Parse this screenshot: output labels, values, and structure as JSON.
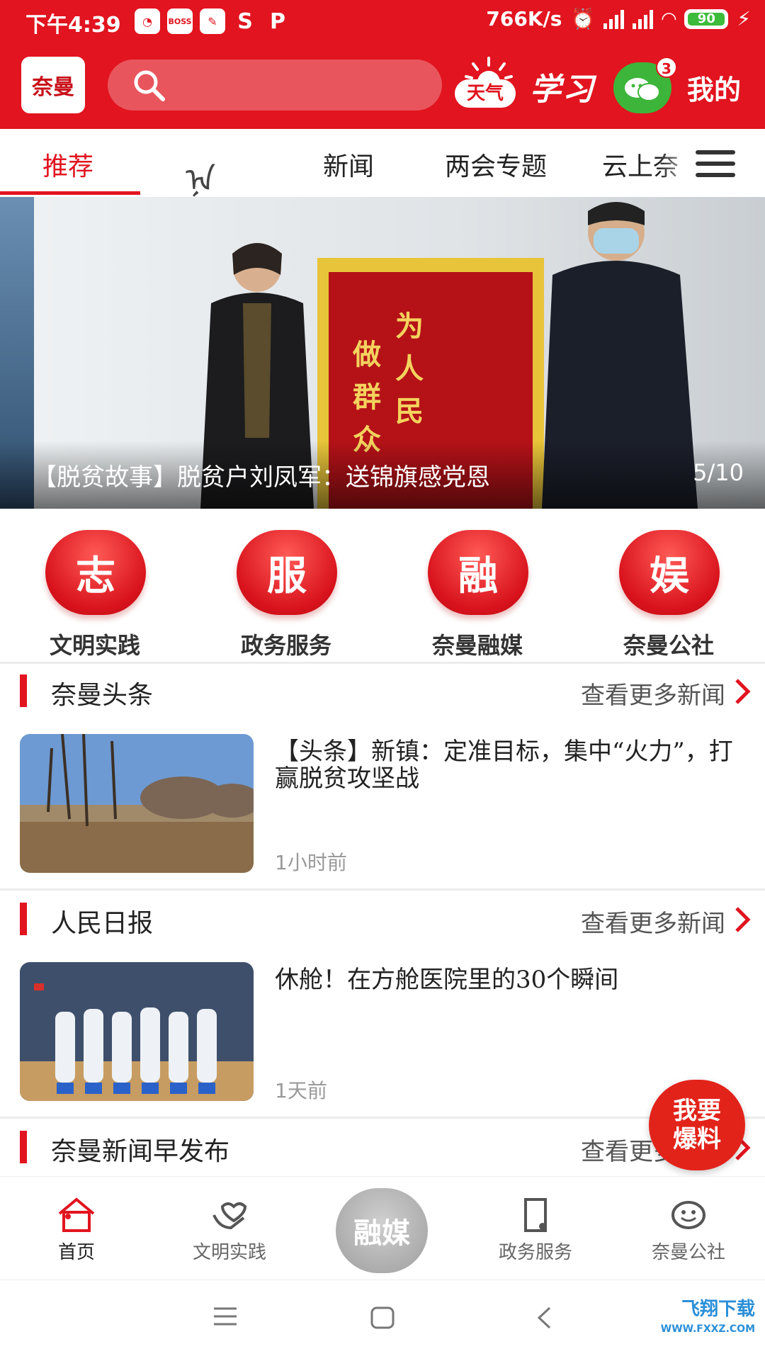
{
  "status_bar": {
    "time": "下午4:39",
    "net_speed": "766K/s",
    "battery": "90",
    "apps": [
      "boss",
      "weibo",
      "s",
      "p"
    ]
  },
  "header": {
    "logo_text": "奈曼",
    "search_placeholder": "",
    "weather_label": "天气",
    "xuexi_label": "学习",
    "wechat_badge": "3",
    "mine_label": "我的"
  },
  "tabs": {
    "items": [
      "推荐",
      "新闻",
      "两会专题",
      "云上奈"
    ],
    "mongol_glyph": "ᠨᠠ",
    "active_index": 0
  },
  "banner": {
    "title": "【脱贫故事】脱贫户刘凤军：送锦旗感党恩",
    "page": "5/10"
  },
  "quick_links": [
    {
      "glyph": "志",
      "label": "文明实践"
    },
    {
      "glyph": "服",
      "label": "政务服务"
    },
    {
      "glyph": "融",
      "label": "奈曼融媒"
    },
    {
      "glyph": "娱",
      "label": "奈曼公社"
    }
  ],
  "sections": [
    {
      "title": "奈曼头条",
      "more": "查看更多新闻",
      "news": {
        "title": "【头条】新镇：定准目标，集中“火力”，打赢脱贫攻坚战",
        "time": "1小时前"
      }
    },
    {
      "title": "人民日报",
      "more": "查看更多新闻",
      "news": {
        "title": "休舱！在方舱医院里的30个瞬间",
        "time": "1天前"
      }
    },
    {
      "title": "奈曼新闻早发布",
      "more": "查看更多新闻"
    }
  ],
  "report_button": {
    "line1": "我要",
    "line2": "爆料"
  },
  "bottom_nav": {
    "items": [
      {
        "label": "首页",
        "icon": "home-icon"
      },
      {
        "label": "文明实践",
        "icon": "hands-icon"
      },
      {
        "label": "政务服务",
        "icon": "document-icon"
      },
      {
        "label": "奈曼公社",
        "icon": "smile-icon"
      }
    ],
    "center_label": "融媒"
  },
  "watermark": {
    "line1": "飞翔下载",
    "line2": "WWW.FXXZ.COM"
  },
  "colors": {
    "brand_red": "#e1141f",
    "wechat_green": "#3db53a",
    "muted_gray": "#9a9a9a"
  }
}
